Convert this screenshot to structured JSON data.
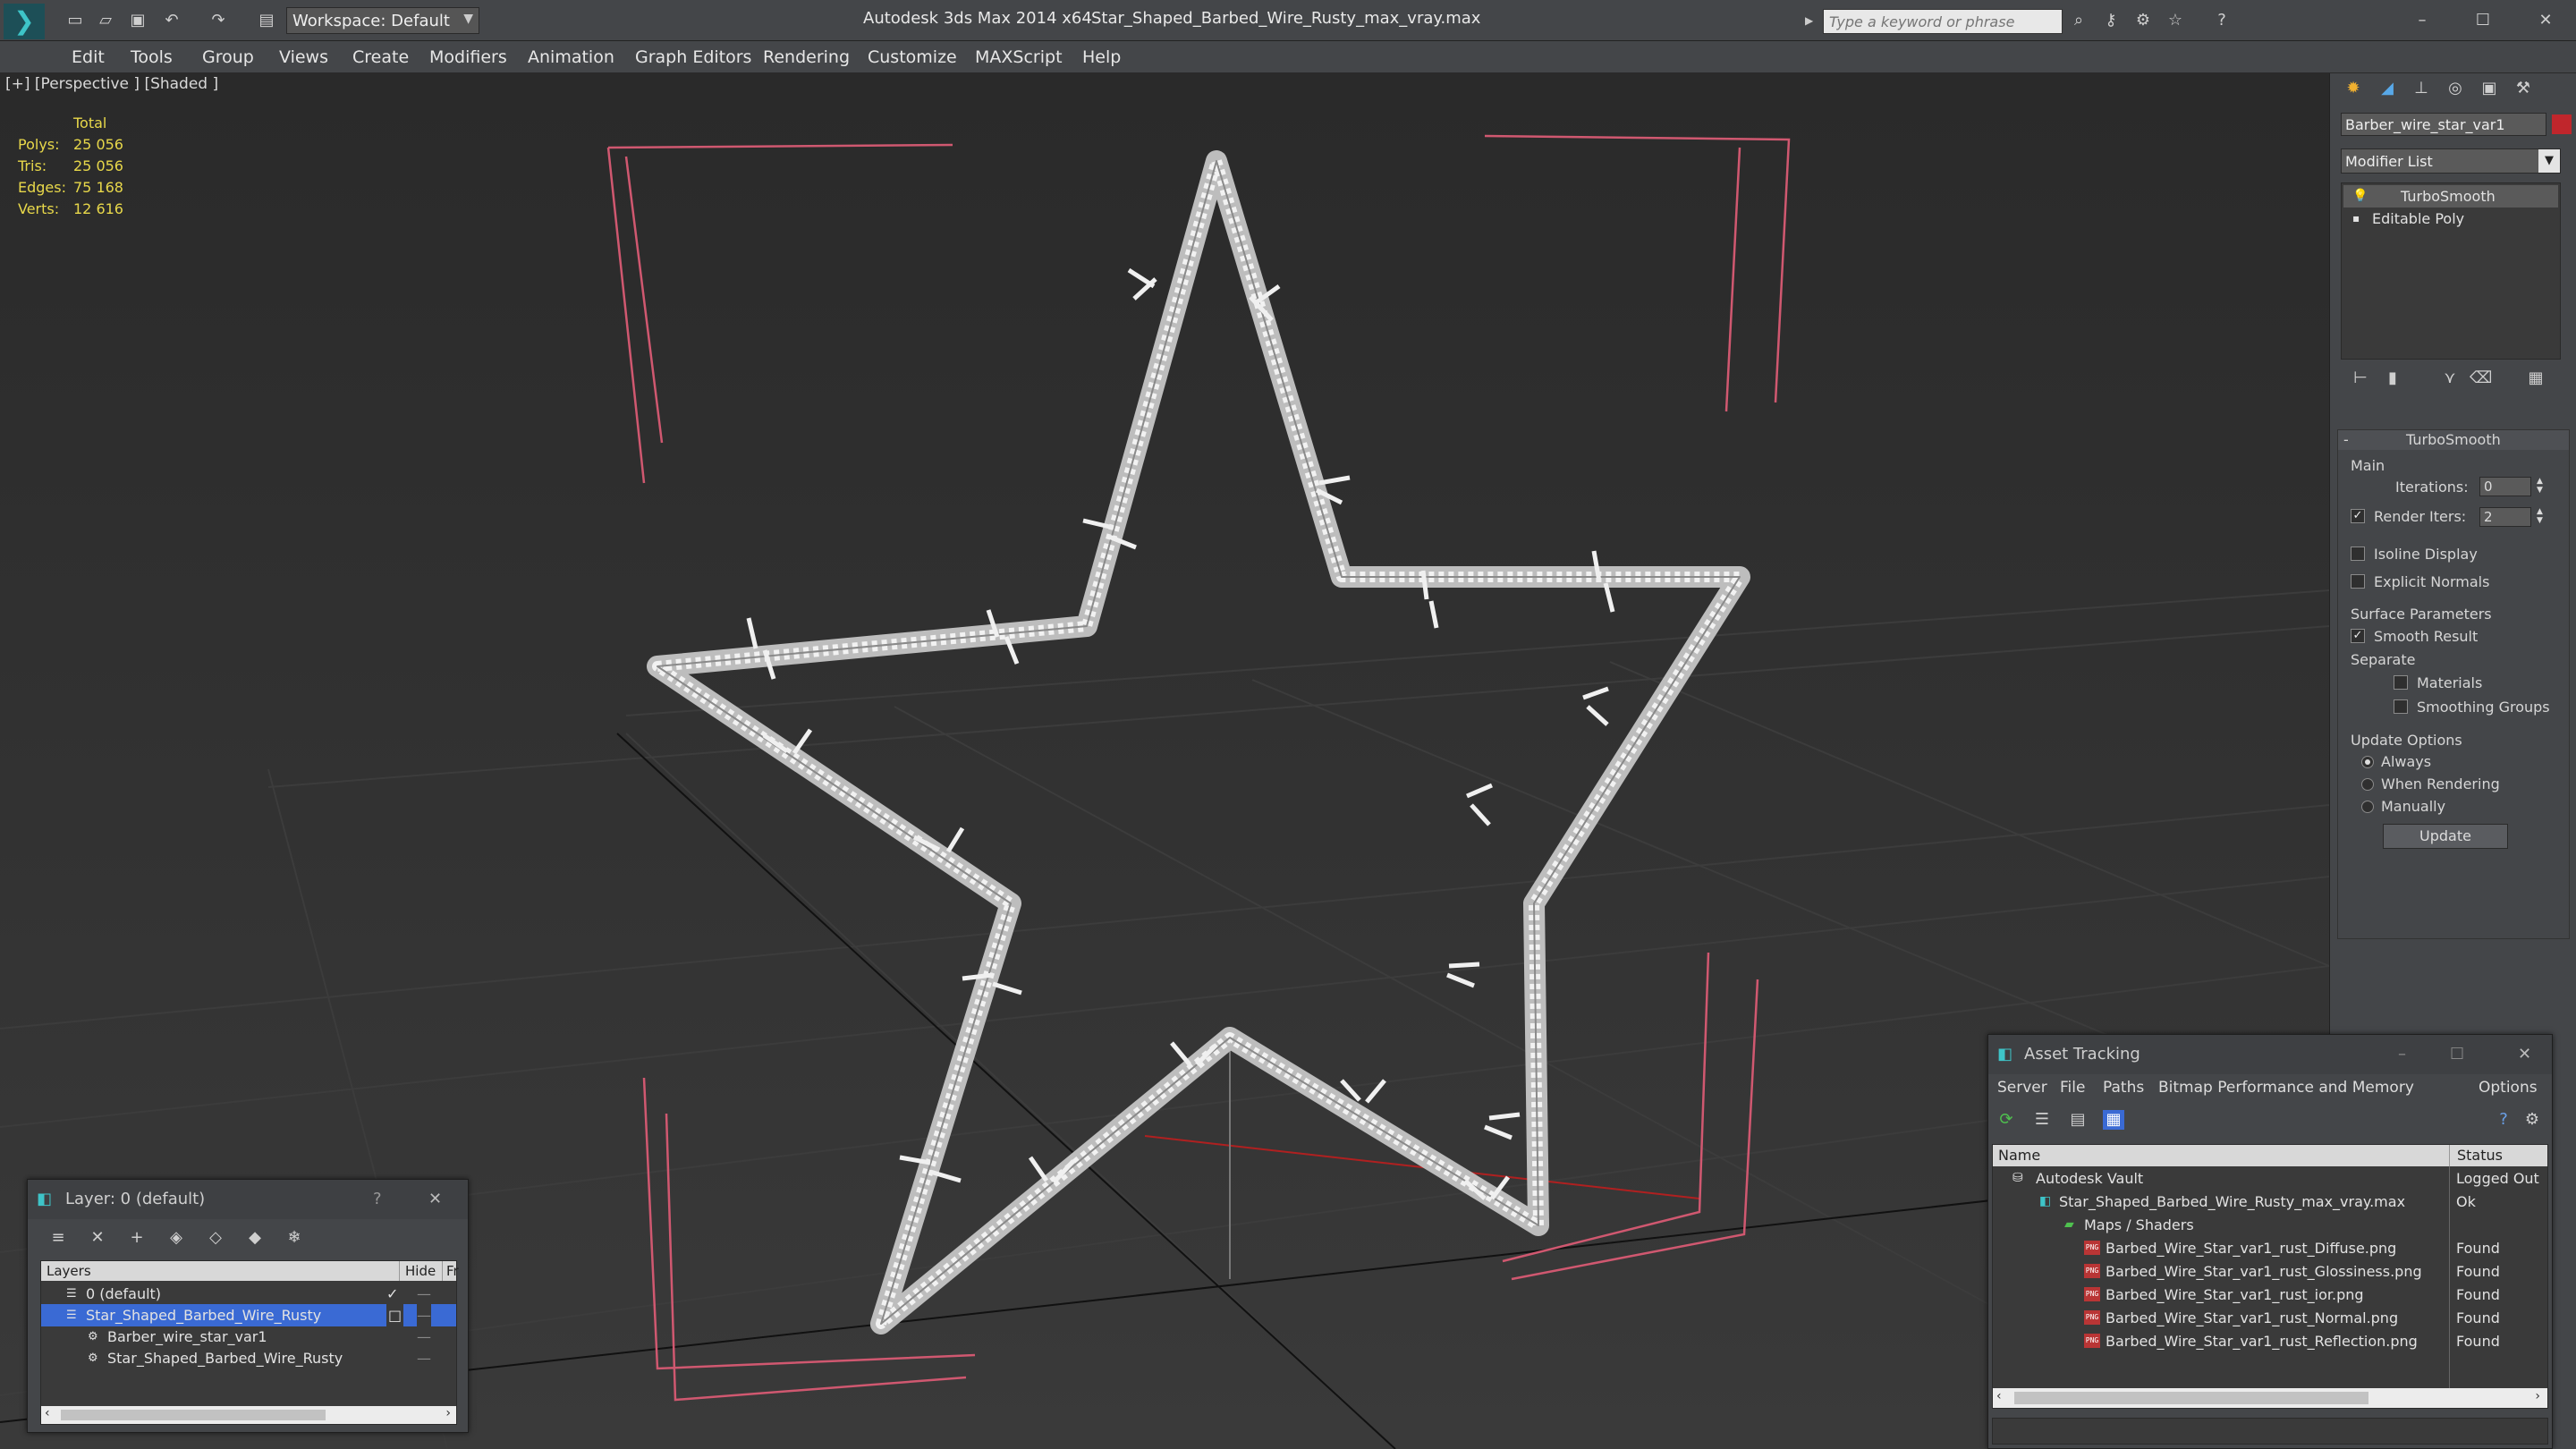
{
  "titlebar": {
    "app_title": "Autodesk 3ds Max 2014 x64",
    "file_name": "Star_Shaped_Barbed_Wire_Rusty_max_vray.max",
    "workspace": "Workspace: Default",
    "search_placeholder": "Type a keyword or phrase"
  },
  "menu": [
    "Edit",
    "Tools",
    "Group",
    "Views",
    "Create",
    "Modifiers",
    "Animation",
    "Graph Editors",
    "Rendering",
    "Customize",
    "MAXScript",
    "Help"
  ],
  "viewport": {
    "label": "[+] [Perspective ] [Shaded ]",
    "stats_header": "Total",
    "stats": [
      {
        "k": "Polys:",
        "v": "25 056"
      },
      {
        "k": "Tris:",
        "v": "25 056"
      },
      {
        "k": "Edges:",
        "v": "75 168"
      },
      {
        "k": "Verts:",
        "v": "12 616"
      }
    ]
  },
  "command_panel": {
    "object_name": "Barber_wire_star_var1",
    "object_color": "#c0262c",
    "modifier_list": "Modifier List",
    "stack": [
      "TurboSmooth",
      "Editable Poly"
    ],
    "rollout_title": "TurboSmooth",
    "main_group": "Main",
    "iterations_label": "Iterations:",
    "iterations_value": "0",
    "render_iters_label": "Render Iters:",
    "render_iters_value": "2",
    "isoline": "Isoline Display",
    "explicit_normals": "Explicit Normals",
    "surface_group": "Surface Parameters",
    "smooth_result": "Smooth Result",
    "separate": "Separate",
    "materials": "Materials",
    "smoothing_groups": "Smoothing Groups",
    "update_group": "Update Options",
    "always": "Always",
    "when_rendering": "When Rendering",
    "manually": "Manually",
    "update_button": "Update"
  },
  "layer_window": {
    "title": "Layer: 0 (default)",
    "help": "?",
    "col_layers": "Layers",
    "col_hide": "Hide",
    "col_fr": "Fr",
    "rows": [
      {
        "name": "0 (default)",
        "indent": 0,
        "selected": false,
        "check": "✓"
      },
      {
        "name": "Star_Shaped_Barbed_Wire_Rusty",
        "indent": 0,
        "selected": true,
        "check": "□"
      },
      {
        "name": "Barber_wire_star_var1",
        "indent": 1,
        "selected": false,
        "check": ""
      },
      {
        "name": "Star_Shaped_Barbed_Wire_Rusty",
        "indent": 1,
        "selected": false,
        "check": ""
      }
    ]
  },
  "asset_window": {
    "title": "Asset Tracking",
    "menu": [
      "Server",
      "File",
      "Paths",
      "Bitmap Performance and Memory",
      "Options"
    ],
    "col_name": "Name",
    "col_status": "Status",
    "rows": [
      {
        "name": "Autodesk Vault",
        "status": "Logged Out",
        "indent": 0,
        "icon": "vault"
      },
      {
        "name": "Star_Shaped_Barbed_Wire_Rusty_max_vray.max",
        "status": "Ok",
        "indent": 1,
        "icon": "max"
      },
      {
        "name": "Maps / Shaders",
        "status": "",
        "indent": 2,
        "icon": "folder"
      },
      {
        "name": "Barbed_Wire_Star_var1_rust_Diffuse.png",
        "status": "Found",
        "indent": 3,
        "icon": "png"
      },
      {
        "name": "Barbed_Wire_Star_var1_rust_Glossiness.png",
        "status": "Found",
        "indent": 3,
        "icon": "png"
      },
      {
        "name": "Barbed_Wire_Star_var1_rust_ior.png",
        "status": "Found",
        "indent": 3,
        "icon": "png"
      },
      {
        "name": "Barbed_Wire_Star_var1_rust_Normal.png",
        "status": "Found",
        "indent": 3,
        "icon": "png"
      },
      {
        "name": "Barbed_Wire_Star_var1_rust_Reflection.png",
        "status": "Found",
        "indent": 3,
        "icon": "png"
      }
    ]
  }
}
